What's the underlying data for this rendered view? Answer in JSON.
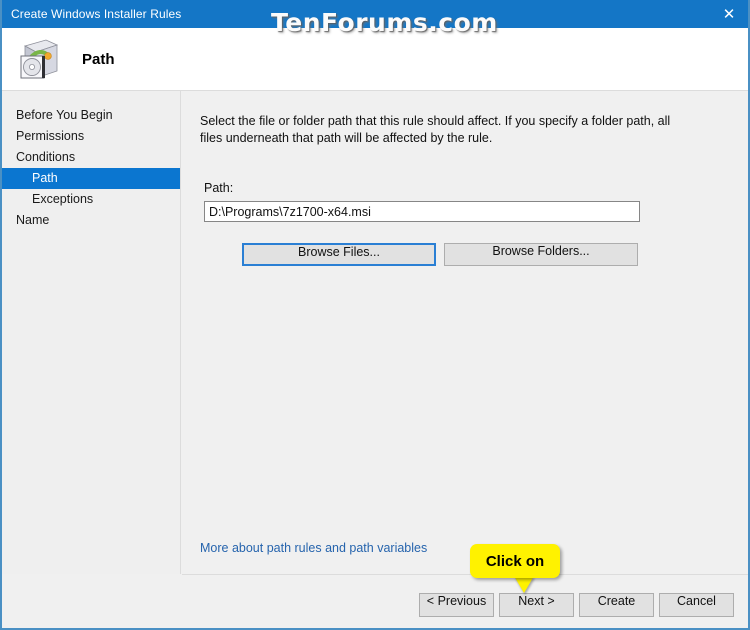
{
  "window": {
    "title": "Create Windows Installer Rules",
    "close_icon": "close-icon",
    "watermark": "TenForums.com"
  },
  "header": {
    "icon": "windows-installer-package-icon",
    "title": "Path"
  },
  "sidebar": {
    "items": [
      {
        "label": "Before You Begin",
        "indent": false,
        "selected": false
      },
      {
        "label": "Permissions",
        "indent": false,
        "selected": false
      },
      {
        "label": "Conditions",
        "indent": false,
        "selected": false
      },
      {
        "label": "Path",
        "indent": true,
        "selected": true
      },
      {
        "label": "Exceptions",
        "indent": true,
        "selected": false
      },
      {
        "label": "Name",
        "indent": false,
        "selected": false
      }
    ]
  },
  "content": {
    "instructions": "Select the file or folder path that this rule should affect. If you specify a folder path, all files underneath that path will be affected by the rule.",
    "path_label": "Path:",
    "path_value": "D:\\Programs\\7z1700-x64.msi",
    "path_placeholder": "",
    "browse_files_label": "Browse Files...",
    "browse_folders_label": "Browse Folders...",
    "more_link_label": "More about path rules and path variables"
  },
  "footer": {
    "previous_label": "< Previous",
    "next_label": "Next >",
    "create_label": "Create",
    "cancel_label": "Cancel"
  },
  "callout": {
    "text": "Click on"
  },
  "colors": {
    "titlebar": "#1476c6",
    "selection": "#0b76d0",
    "window_border": "#4a90c4",
    "link": "#2664ad",
    "callout": "#fff200",
    "focus_border": "#2a7fd4"
  }
}
